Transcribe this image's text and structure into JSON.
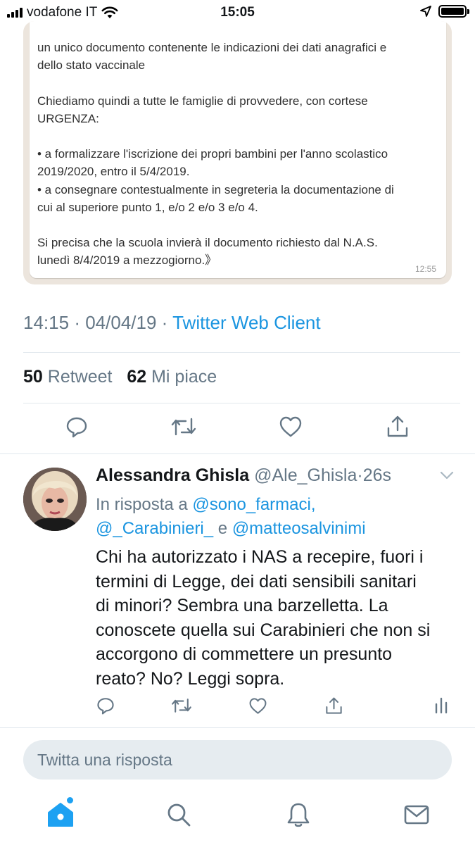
{
  "status_bar": {
    "carrier": "vodafone IT",
    "time": "15:05"
  },
  "message_image": {
    "text": "un unico documento contenente le indicazioni dei dati anagrafici e\ndello stato vaccinale\n\nChiediamo quindi a tutte le famiglie di provvedere, con cortese\nURGENZA:\n\n• a formalizzare l'iscrizione dei propri bambini per l'anno scolastico\n2019/2020, entro il 5/4/2019.\n• a consegnare contestualmente in segreteria la documentazione di\ncui al superiore punto 1, e/o 2 e/o 3 e/o 4.\n\nSi precisa che la scuola invierà il documento richiesto dal N.A.S.\nlunedì 8/4/2019 a mezzogiorno.》",
    "time": "12:55"
  },
  "tweet": {
    "time": "14:15",
    "separator": "·",
    "date": "04/04/19",
    "client": "Twitter Web Client",
    "retweet_count": "50",
    "retweet_label": "Retweet",
    "like_count": "62",
    "like_label": "Mi piace"
  },
  "reply": {
    "name": "Alessandra Ghisla",
    "handle": "@Ale_Ghisla",
    "age": "26s",
    "in_reply_prefix": "In risposta a",
    "mention_1": "@sono_farmaci,",
    "mention_2": "@_Carabinieri_",
    "conjunction": "e",
    "mention_3": "@matteosalvinimi",
    "text": "Chi ha autorizzato i NAS a recepire, fuori i\ntermini di Legge, dei dati sensibili sanitari\ndi minori? Sembra una barzelletta. La\nconoscete quella sui Carabinieri che non si\naccorgono di commettere un presunto\nreato? No? Leggi sopra."
  },
  "composer": {
    "placeholder": "Twitta una risposta"
  },
  "colors": {
    "accent": "#1DA1F2",
    "link": "#1B95E0",
    "secondary_text": "#657786"
  },
  "icons": {
    "tweet_actions": [
      "reply-icon",
      "retweet-icon",
      "like-icon",
      "share-icon"
    ],
    "reply_actions": [
      "reply-icon",
      "retweet-icon",
      "like-icon",
      "share-icon",
      "analytics-icon"
    ],
    "tabs": [
      "home-icon",
      "search-icon",
      "notifications-icon",
      "messages-icon"
    ]
  }
}
